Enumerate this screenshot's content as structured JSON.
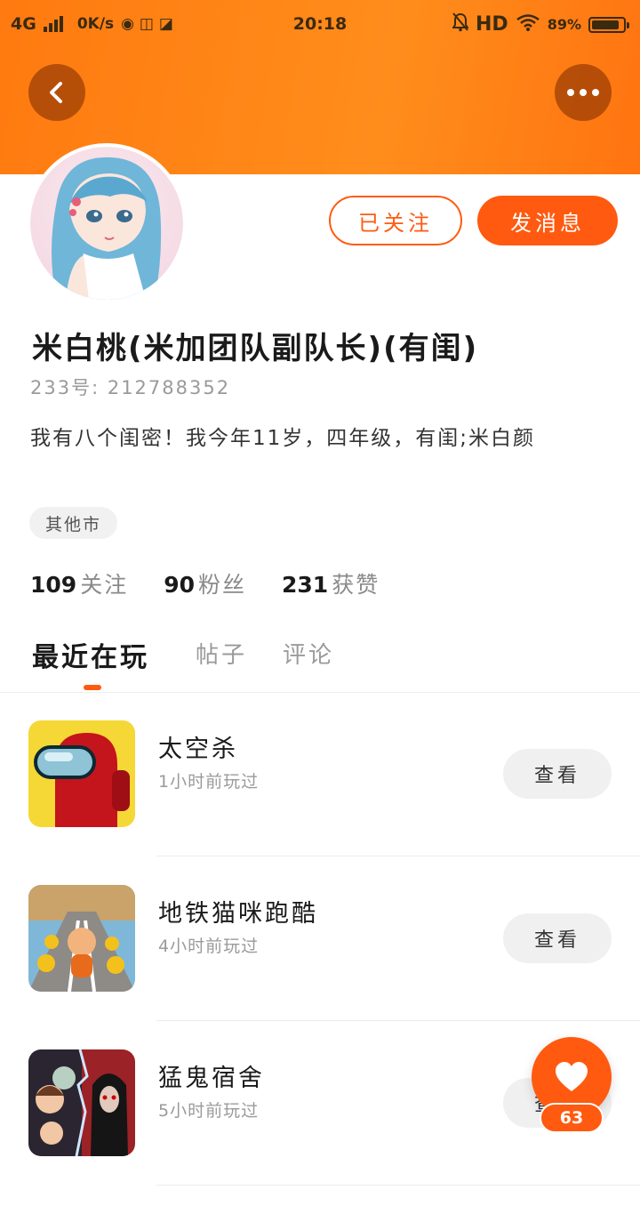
{
  "status_bar": {
    "network": "4G",
    "speed": "0K/s",
    "time": "20:18",
    "hd": "HD",
    "battery": "89%",
    "battery_level": 0.89
  },
  "header": {
    "back_icon": "chevron-left-icon",
    "more_icon": "more-horizontal-icon",
    "accent_color": "#ff5a10"
  },
  "profile": {
    "avatar_icon": "anime-girl-avatar",
    "follow_label": "已关注",
    "message_label": "发消息",
    "username": "米白桃(米加团队副队长)(有闺)",
    "user_id": "233号: 212788352",
    "bio": "我有八个闺密！我今年11岁，四年级，有闺;米白颜",
    "location": "其他市",
    "stats": [
      {
        "num": "109",
        "label": "关注"
      },
      {
        "num": "90",
        "label": "粉丝"
      },
      {
        "num": "231",
        "label": "获赞"
      }
    ]
  },
  "tabs": [
    {
      "label": "最近在玩",
      "active": true
    },
    {
      "label": "帖子",
      "active": false
    },
    {
      "label": "评论",
      "active": false
    }
  ],
  "games": [
    {
      "name": "太空杀",
      "time": "1小时前玩过",
      "button": "查看",
      "icon": "among-us-icon"
    },
    {
      "name": "地铁猫咪跑酷",
      "time": "4小时前玩过",
      "button": "查看",
      "icon": "subway-cat-runner-icon"
    },
    {
      "name": "猛鬼宿舍",
      "time": "5小时前玩过",
      "button": "查看",
      "icon": "haunted-dorm-icon"
    }
  ],
  "like_fab": {
    "icon": "heart-icon",
    "count": "63"
  }
}
